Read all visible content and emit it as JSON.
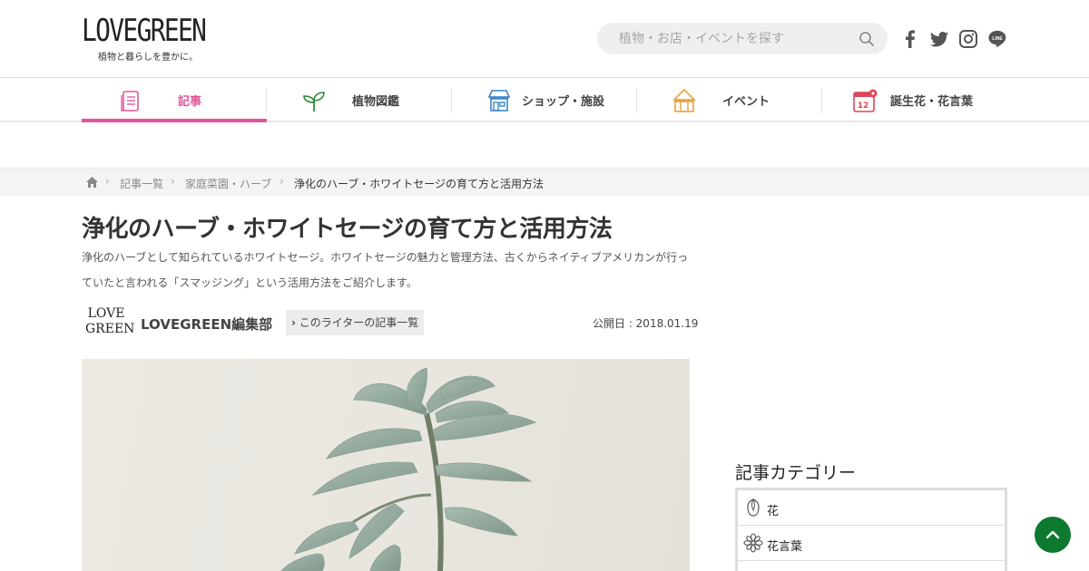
{
  "header": {
    "logo_text": "LOVEGREEN",
    "logo_tagline": "植物と暮らしを豊かに。",
    "search_placeholder": "植物・お店・イベントを探す",
    "social_icons": [
      "facebook-icon",
      "twitter-icon",
      "instagram-icon",
      "line-icon"
    ]
  },
  "nav": {
    "items": [
      {
        "label": "記事",
        "icon": "article-icon",
        "active": true
      },
      {
        "label": "植物図鑑",
        "icon": "sprout-icon",
        "active": false
      },
      {
        "label": "ショップ・施設",
        "icon": "shop-icon",
        "active": false
      },
      {
        "label": "イベント",
        "icon": "tent-icon",
        "active": false
      },
      {
        "label": "誕生花・花言葉",
        "icon": "calendar-icon",
        "active": false
      }
    ]
  },
  "breadcrumb": {
    "items": [
      "記事一覧",
      "家庭菜園・ハーブ",
      "浄化のハーブ・ホワイトセージの育て方と活用方法"
    ]
  },
  "article": {
    "title": "浄化のハーブ・ホワイトセージの育て方と活用方法",
    "lead": "浄化のハーブとして知られているホワイトセージ。ホワイトセージの魅力と管理方法、古くからネイティブアメリカンが行っていたと言われる「スマッジング」という活用方法をご紹介します。",
    "author_logo_line1": "LOVE",
    "author_logo_line2": "GREEN",
    "author_name": "LOVEGREEN編集部",
    "writer_link": "このライターの記事一覧",
    "published": "公開日 : 2018.01.19"
  },
  "sidebar": {
    "title": "記事カテゴリー",
    "categories": [
      {
        "label": "花",
        "icon": "flower-bud-icon"
      },
      {
        "label": "花言葉",
        "icon": "flower-icon"
      }
    ]
  },
  "colors": {
    "accent_pink": "#e5559c",
    "totop_green": "#0d7a2f"
  }
}
